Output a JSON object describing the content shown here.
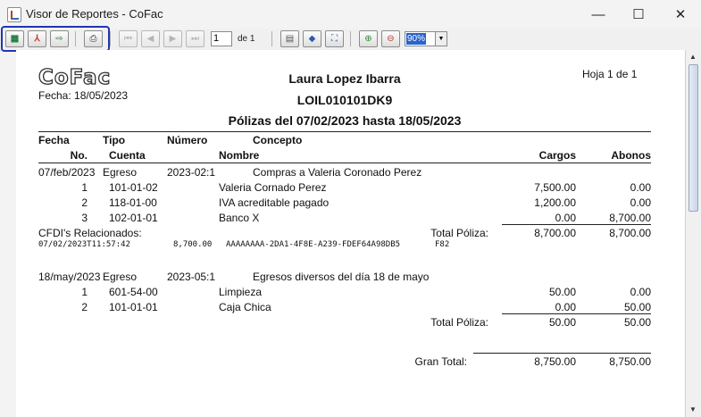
{
  "window": {
    "title": "Visor de Reportes - CoFac",
    "minimize": "—",
    "maximize": "☐",
    "close": "✕"
  },
  "toolbar": {
    "current_page": "1",
    "page_of": "de 1",
    "zoom": "90%"
  },
  "report": {
    "logo_text": "CoFac",
    "fecha": "Fecha: 18/05/2023",
    "hoja": "Hoja 1 de 1",
    "name": "Laura Lopez Ibarra",
    "rfc": "LOIL010101DK9",
    "subtitle": "Pólizas del 07/02/2023 hasta 18/05/2023",
    "headers": {
      "fecha": "Fecha",
      "tipo": "Tipo",
      "numero": "Número",
      "concepto": "Concepto",
      "no": "No.",
      "cuenta": "Cuenta",
      "nombre": "Nombre",
      "cargos": "Cargos",
      "abonos": "Abonos"
    },
    "polizas": [
      {
        "fecha": "07/feb/2023",
        "tipo": "Egreso",
        "numero": "2023-02:1",
        "concepto": "Compras a Valeria Coronado Perez",
        "lines": [
          {
            "no": "1",
            "cuenta": "101-01-02",
            "nombre": "Valeria Cornado Perez",
            "cargo": "7,500.00",
            "abono": "0.00"
          },
          {
            "no": "2",
            "cuenta": "118-01-00",
            "nombre": "IVA acreditable pagado",
            "cargo": "1,200.00",
            "abono": "0.00"
          },
          {
            "no": "3",
            "cuenta": "102-01-01",
            "nombre": "Banco X",
            "cargo": "0.00",
            "abono": "8,700.00"
          }
        ],
        "cfdi_label": "CFDI's Relacionados:",
        "total_label": "Total Póliza:",
        "total_cargos": "8,700.00",
        "total_abonos": "8,700.00",
        "cfdi": {
          "fecha": "07/02/2023T11:57:42",
          "monto": "8,700.00",
          "uuid": "AAAAAAAA-2DA1-4F8E-A239-FDEF64A98DB5",
          "forma": "F82"
        }
      },
      {
        "fecha": "18/may/2023",
        "tipo": "Egreso",
        "numero": "2023-05:1",
        "concepto": "Egresos diversos del día 18 de mayo",
        "lines": [
          {
            "no": "1",
            "cuenta": "601-54-00",
            "nombre": "Limpieza",
            "cargo": "50.00",
            "abono": "0.00"
          },
          {
            "no": "2",
            "cuenta": "101-01-01",
            "nombre": "Caja Chica",
            "cargo": "0.00",
            "abono": "50.00"
          }
        ],
        "total_label": "Total Póliza:",
        "total_cargos": "50.00",
        "total_abonos": "50.00"
      }
    ],
    "gran_total_label": "Gran Total:",
    "gran_total_cargos": "8,750.00",
    "gran_total_abonos": "8,750.00"
  },
  "colors": {
    "highlight": "#1f35b5",
    "zoom_selection": "#2a64c8"
  }
}
